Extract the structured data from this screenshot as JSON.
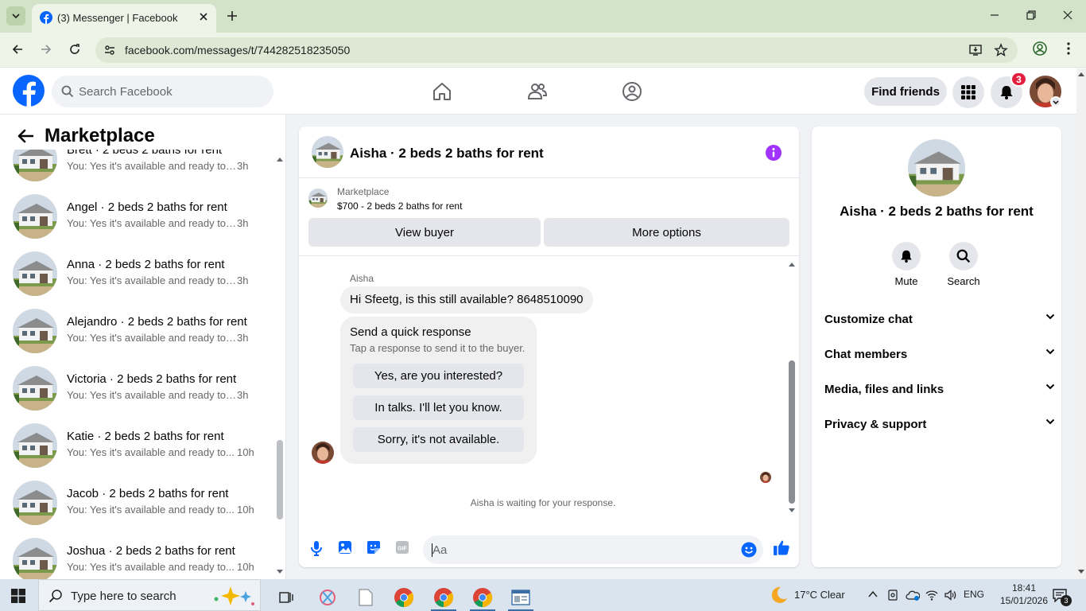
{
  "browser": {
    "tab_title": "(3) Messenger | Facebook",
    "url": "facebook.com/messages/t/744282518235050"
  },
  "header": {
    "search_placeholder": "Search Facebook",
    "find_friends_label": "Find friends",
    "notification_count": "3"
  },
  "sidebar": {
    "title": "Marketplace",
    "conversations": [
      {
        "name": "Brett · 2 beds 2 baths for rent",
        "snippet": "You: Yes it's available and ready to ...",
        "time": "3h"
      },
      {
        "name": "Angel · 2 beds 2 baths for rent",
        "snippet": "You: Yes it's available and ready to ...",
        "time": "3h"
      },
      {
        "name": "Anna · 2 beds 2 baths for rent",
        "snippet": "You: Yes it's available and ready to ...",
        "time": "3h"
      },
      {
        "name": "Alejandro · 2 beds 2 baths for rent",
        "snippet": "You: Yes it's available and ready to ...",
        "time": "3h"
      },
      {
        "name": "Victoria · 2 beds 2 baths for rent",
        "snippet": "You: Yes it's available and ready to ...",
        "time": "3h"
      },
      {
        "name": "Katie · 2 beds 2 baths for rent",
        "snippet": "You: Yes it's available and ready to...",
        "time": "10h"
      },
      {
        "name": "Jacob · 2 beds 2 baths for rent",
        "snippet": "You: Yes it's available and ready to...",
        "time": "10h"
      },
      {
        "name": "Joshua · 2 beds 2 baths for rent",
        "snippet": "You: Yes it's available and ready to...",
        "time": "10h"
      }
    ]
  },
  "chat": {
    "title": "Aisha · 2 beds 2 baths for rent",
    "marketplace_label": "Marketplace",
    "listing": "$700 - 2 beds 2 baths for rent",
    "view_buyer_label": "View buyer",
    "more_options_label": "More options",
    "sender_name": "Aisha",
    "message": "Hi Sfeetg, is this still available? 8648510090",
    "quick_title": "Send a quick response",
    "quick_subtitle": "Tap a response to send it to the buyer.",
    "quick_replies": [
      "Yes, are you interested?",
      "In talks. I'll let you know.",
      "Sorry, it's not available."
    ],
    "waiting_text": "Aisha is waiting for your response.",
    "input_placeholder": "Aa"
  },
  "details": {
    "name": "Aisha · 2 beds 2 baths for rent",
    "mute_label": "Mute",
    "search_label": "Search",
    "sections": [
      "Customize chat",
      "Chat members",
      "Media, files and links",
      "Privacy & support"
    ]
  },
  "taskbar": {
    "search_text": "Type here to search",
    "weather": "17°C  Clear",
    "language": "ENG",
    "time": "18:41",
    "date": "15/01/2026",
    "notification_count": "3"
  },
  "colors": {
    "fb_blue": "#0866ff",
    "messenger_purple": "#a033ff",
    "chrome_green": "#d3e3c9",
    "badge_red": "#e41e3f"
  }
}
